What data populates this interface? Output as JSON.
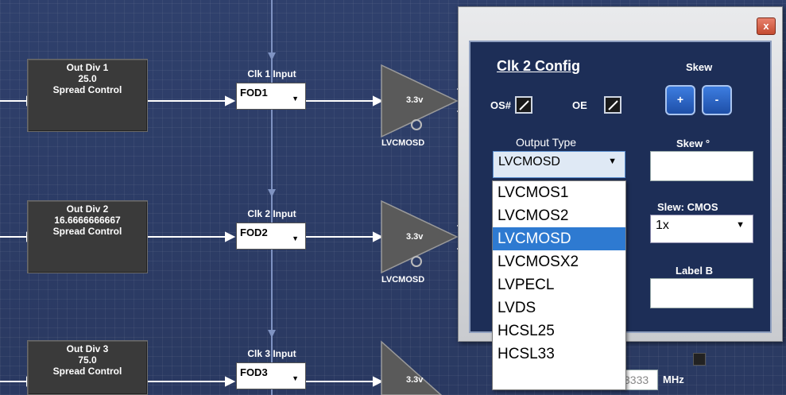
{
  "dividers": [
    {
      "title": "Out Div 1",
      "value": "25.0",
      "sub": "Spread Control"
    },
    {
      "title": "Out Div 2",
      "value": "16.6666666667",
      "sub": "Spread Control"
    },
    {
      "title": "Out Div 3",
      "value": "75.0",
      "sub": "Spread Control"
    }
  ],
  "clocks": [
    {
      "label": "Clk 1 Input",
      "source": "FOD1",
      "voltage": "3.3v",
      "type": "LVCMOSD"
    },
    {
      "label": "Clk 2 Input",
      "source": "FOD2",
      "voltage": "3.3v",
      "type": "LVCMOSD"
    },
    {
      "label": "Clk 3 Input",
      "source": "FOD3",
      "voltage": "3.3v"
    }
  ],
  "freq_partial": "3333",
  "freq_unit": "MHz",
  "dialog": {
    "close_glyph": "x",
    "title": "Clk 2 Config",
    "skew_label": "Skew",
    "plus_label": "+",
    "minus_label": "-",
    "os_label": "OS#",
    "oe_label": "OE",
    "output_type_label": "Output Type",
    "output_type_value": "LVCMOSD",
    "output_type_options": [
      "LVCMOS1",
      "LVCMOS2",
      "LVCMOSD",
      "LVCMOSX2",
      "LVPECL",
      "LVDS",
      "HCSL25",
      "HCSL33"
    ],
    "selected_option": "LVCMOSD",
    "skew_deg_label": "Skew °",
    "slew_label": "Slew: CMOS",
    "slew_value": "1x",
    "label_b": "Label B"
  }
}
